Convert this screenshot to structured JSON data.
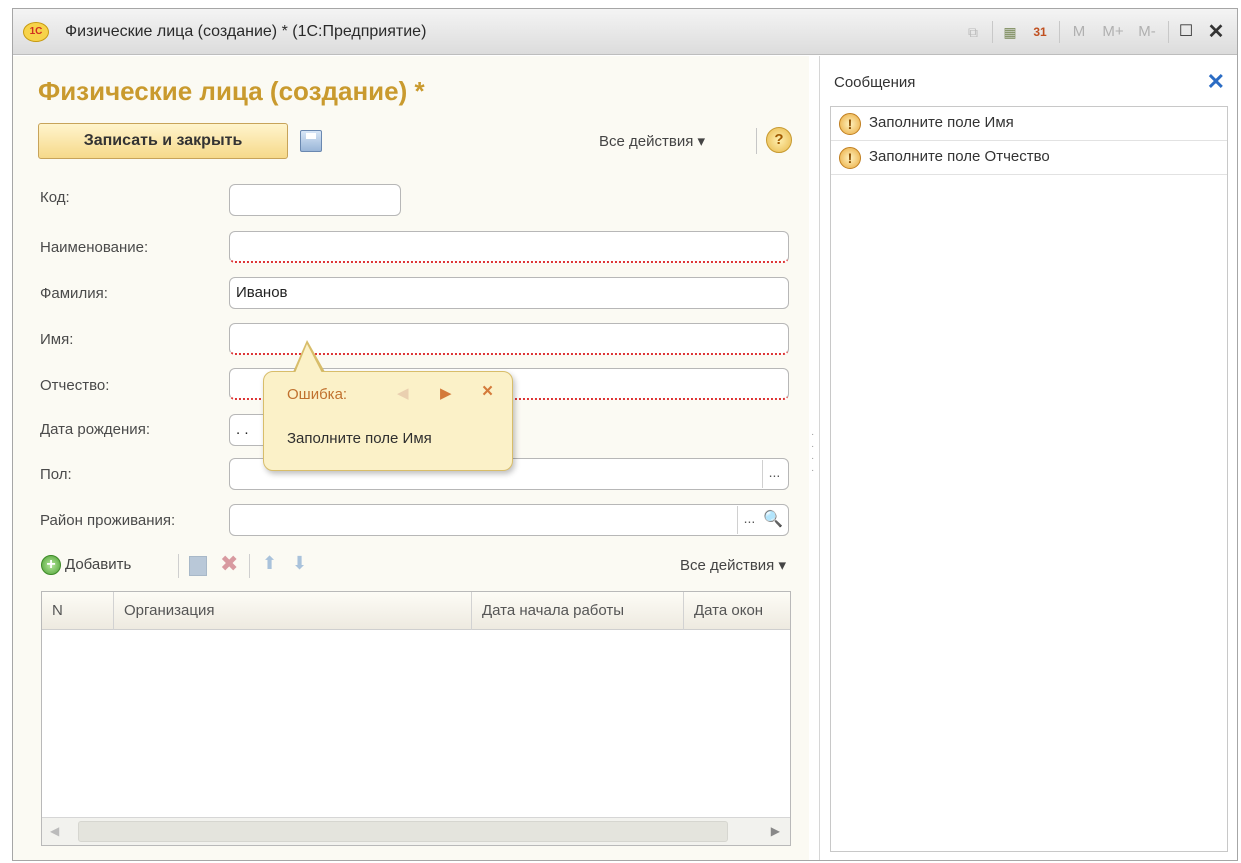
{
  "window": {
    "app_logo": "1С",
    "title": "Физические лица (создание) * (1С:Предприятие)",
    "toolbar_icons": [
      "copy-icon",
      "calculator-icon",
      "calendar-icon",
      "memory-m-icon",
      "memory-plus-icon",
      "memory-minus-icon",
      "window-icon",
      "close-icon"
    ],
    "mem_labels": [
      "M",
      "M+",
      "M-"
    ],
    "calendar_label": "31"
  },
  "form": {
    "title": "Физические лица (создание) *",
    "save_close_label": "Записать и закрыть",
    "all_actions_label": "Все действия ▾",
    "help_label": "?",
    "fields": {
      "code_label": "Код:",
      "code_value": "",
      "name_label": "Наименование:",
      "name_value": "",
      "surname_label": "Фамилия:",
      "surname_value": "Иванов",
      "firstname_label": "Имя:",
      "firstname_value": "",
      "patronymic_label": "Отчество:",
      "patronymic_value": "",
      "birthdate_label": "Дата рождения:",
      "birthdate_value": ". .",
      "gender_label": "Пол:",
      "gender_value": "",
      "district_label": "Район проживания:",
      "district_value": ""
    },
    "choice_button": "...",
    "search_button": "🔍"
  },
  "balloon": {
    "title": "Ошибка:",
    "text": "Заполните поле Имя"
  },
  "table": {
    "add_label": "Добавить",
    "all_actions_label": "Все действия ▾",
    "columns": [
      "N",
      "Организация",
      "Дата начала работы",
      "Дата окон"
    ],
    "rows": []
  },
  "messages": {
    "title": "Сообщения",
    "items": [
      {
        "text": "Заполните поле Имя"
      },
      {
        "text": "Заполните поле Отчество"
      }
    ]
  },
  "colors": {
    "title_accent": "#c99a2e",
    "required_underline": "#dd3333",
    "balloon_bg": "#fbf1c8",
    "close_blue": "#2b6cc4"
  }
}
